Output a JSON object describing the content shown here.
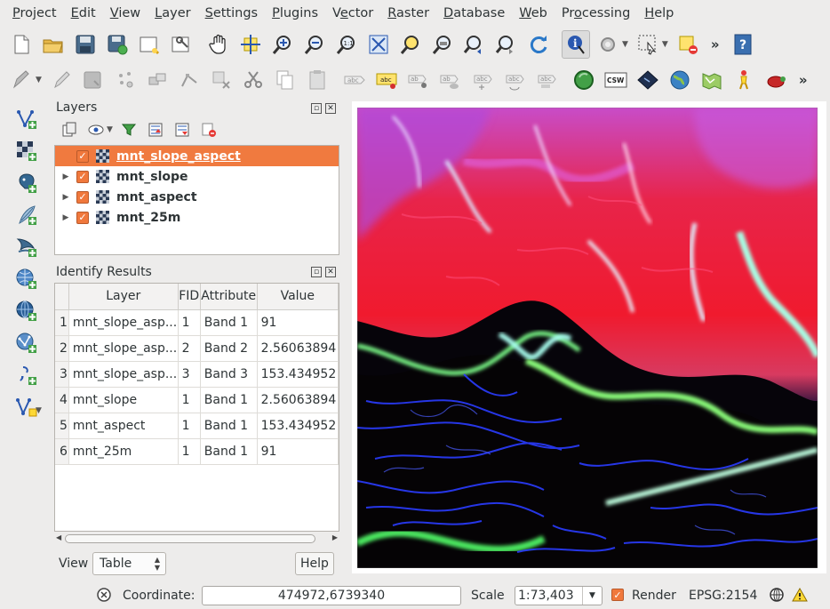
{
  "menubar": {
    "items": [
      "Project",
      "Edit",
      "View",
      "Layer",
      "Settings",
      "Plugins",
      "Vector",
      "Raster",
      "Database",
      "Web",
      "Processing",
      "Help"
    ],
    "underline_index": [
      0,
      0,
      0,
      0,
      0,
      0,
      1,
      0,
      0,
      0,
      2,
      0
    ]
  },
  "toolbar1": {
    "icons": [
      "new-project-icon",
      "open-project-icon",
      "save-project-icon",
      "save-as-icon",
      "new-print-composer-icon",
      "composer-manager-icon",
      "pan-icon",
      "pan-to-selection-icon",
      "zoom-in-icon",
      "zoom-out-icon",
      "zoom-actual-size-icon",
      "zoom-full-icon",
      "zoom-to-selection-icon",
      "zoom-to-layer-icon",
      "zoom-last-icon",
      "zoom-next-icon",
      "refresh-icon",
      "identify-icon",
      "action-icon",
      "select-features-icon",
      "deselect-icon",
      "help-icon"
    ],
    "more": "»"
  },
  "toolbar2": {
    "icons": [
      "digitize-icon",
      "edit-pencil-icon",
      "save-edits-icon",
      "add-feature-icon",
      "move-feature-icon",
      "node-tool-icon",
      "delete-selected-icon",
      "cut-features-icon",
      "copy-features-icon",
      "paste-features-icon",
      "label-icon",
      "label-highlight-icon",
      "label-pin-icon",
      "label-show-hide-icon",
      "label-move-icon",
      "label-rotate-icon",
      "label-change-icon",
      "globe-green-icon",
      "csw-icon",
      "georeferencer-icon",
      "earth-icon",
      "green-map-icon",
      "yellow-figure-icon",
      "red-turtle-icon"
    ],
    "csw_label": "CSW",
    "more": "»"
  },
  "left_toolbar": {
    "icons": [
      "add-vector-layer-icon",
      "add-raster-layer-icon",
      "add-postgis-layer-icon",
      "add-spatialite-layer-icon",
      "add-mssql-layer-icon",
      "add-wms-layer-icon",
      "add-wcs-layer-icon",
      "add-wfs-layer-icon",
      "add-delimited-text-icon",
      "new-shapefile-icon"
    ]
  },
  "layers_panel": {
    "title": "Layers",
    "layers": [
      {
        "name": "mnt_slope_aspect",
        "checked": true,
        "selected": true,
        "expandable": false
      },
      {
        "name": "mnt_slope",
        "checked": true,
        "selected": false,
        "expandable": true
      },
      {
        "name": "mnt_aspect",
        "checked": true,
        "selected": false,
        "expandable": true
      },
      {
        "name": "mnt_25m",
        "checked": true,
        "selected": false,
        "expandable": true
      }
    ]
  },
  "identify_panel": {
    "title": "Identify Results",
    "columns": [
      "Layer",
      "FID",
      "Attribute",
      "Value"
    ],
    "rows": [
      {
        "num": "1",
        "layer": "mnt_slope_asp...",
        "fid": "1",
        "attribute": "Band 1",
        "value": "91"
      },
      {
        "num": "2",
        "layer": "mnt_slope_asp...",
        "fid": "2",
        "attribute": "Band 2",
        "value": "2.56063894"
      },
      {
        "num": "3",
        "layer": "mnt_slope_asp...",
        "fid": "3",
        "attribute": "Band 3",
        "value": "153.434952"
      },
      {
        "num": "4",
        "layer": "mnt_slope",
        "fid": "1",
        "attribute": "Band 1",
        "value": "2.56063894"
      },
      {
        "num": "5",
        "layer": "mnt_aspect",
        "fid": "1",
        "attribute": "Band 1",
        "value": "153.434952"
      },
      {
        "num": "6",
        "layer": "mnt_25m",
        "fid": "1",
        "attribute": "Band 1",
        "value": "91"
      }
    ],
    "view_label": "View",
    "view_value": "Table",
    "help_label": "Help"
  },
  "statusbar": {
    "coordinate_label": "Coordinate:",
    "coordinate_value": "474972,6739340",
    "scale_label": "Scale",
    "scale_value": "1:73,403",
    "render_label": "Render",
    "render_checked": true,
    "crs": "EPSG:2154"
  },
  "colors": {
    "accent": "#f07a3f",
    "background": "#edeceb"
  }
}
